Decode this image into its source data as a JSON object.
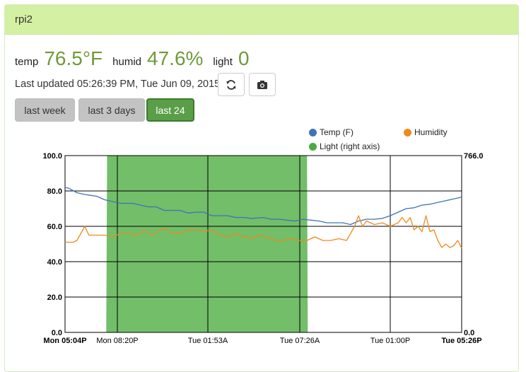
{
  "panel": {
    "title": "rpi2"
  },
  "readings": [
    {
      "label": "temp",
      "value": "76.5°F"
    },
    {
      "label": "humid",
      "value": "47.6%"
    },
    {
      "label": "light",
      "value": "0"
    }
  ],
  "status": {
    "last_updated": "Last updated 05:26:39 PM, Tue Jun 09, 2015"
  },
  "toolbar": {
    "refresh_icon": "refresh-icon",
    "camera_icon": "camera-icon"
  },
  "ranges": [
    {
      "label": "last week",
      "active": false
    },
    {
      "label": "last 3 days",
      "active": false
    },
    {
      "label": "last 24",
      "active": true
    }
  ],
  "colors": {
    "temp": "#3f73b8",
    "humidity": "#f0891d",
    "light": "#4aac3f",
    "accent": "#5a9f48",
    "header": "#d4f0a3"
  },
  "chart_data": {
    "type": "line",
    "x_ticks": [
      "Mon 05:04P",
      "Mon 08:20P",
      "Tue 01:53A",
      "Tue 07:26A",
      "Tue 01:00P",
      "Tue 05:26P"
    ],
    "x_ticks_bold": [
      true,
      false,
      false,
      false,
      false,
      true
    ],
    "y_left_ticks": [
      "100.0",
      "80.0",
      "60.0",
      "40.0",
      "20.0",
      "0.0"
    ],
    "y_right_ticks": [
      "766.0",
      "0.0"
    ],
    "ylim_left": [
      0,
      100
    ],
    "ylim_right": [
      0,
      766
    ],
    "grid": true,
    "legend_position": "top-right",
    "series": [
      {
        "name": "Temp (F)",
        "axis": "left",
        "points": [
          [
            0,
            82
          ],
          [
            0.01,
            81.5
          ],
          [
            0.03,
            79
          ],
          [
            0.05,
            78
          ],
          [
            0.08,
            77
          ],
          [
            0.1,
            75
          ],
          [
            0.12,
            74
          ],
          [
            0.14,
            73
          ],
          [
            0.17,
            73
          ],
          [
            0.19,
            72
          ],
          [
            0.21,
            71
          ],
          [
            0.23,
            71
          ],
          [
            0.25,
            69
          ],
          [
            0.27,
            69
          ],
          [
            0.29,
            69
          ],
          [
            0.31,
            67.5
          ],
          [
            0.33,
            68
          ],
          [
            0.35,
            68
          ],
          [
            0.37,
            66
          ],
          [
            0.39,
            66
          ],
          [
            0.41,
            66
          ],
          [
            0.43,
            65
          ],
          [
            0.45,
            65
          ],
          [
            0.47,
            64.5
          ],
          [
            0.5,
            65
          ],
          [
            0.52,
            64
          ],
          [
            0.54,
            64
          ],
          [
            0.56,
            63.5
          ],
          [
            0.58,
            63
          ],
          [
            0.6,
            64
          ],
          [
            0.62,
            63.5
          ],
          [
            0.64,
            63
          ],
          [
            0.66,
            62
          ],
          [
            0.68,
            62
          ],
          [
            0.7,
            62
          ],
          [
            0.72,
            61
          ],
          [
            0.74,
            63
          ],
          [
            0.76,
            64
          ],
          [
            0.78,
            64
          ],
          [
            0.8,
            64.5
          ],
          [
            0.82,
            66
          ],
          [
            0.84,
            68
          ],
          [
            0.86,
            70
          ],
          [
            0.88,
            70.5
          ],
          [
            0.9,
            72
          ],
          [
            0.92,
            72.5
          ],
          [
            0.94,
            73.5
          ],
          [
            0.96,
            74.5
          ],
          [
            0.98,
            75.5
          ],
          [
            1,
            76.5
          ]
        ]
      },
      {
        "name": "Humidity",
        "axis": "left",
        "points": [
          [
            0,
            51
          ],
          [
            0.02,
            51
          ],
          [
            0.03,
            52
          ],
          [
            0.04,
            56
          ],
          [
            0.05,
            60
          ],
          [
            0.06,
            55
          ],
          [
            0.08,
            55
          ],
          [
            0.1,
            55
          ],
          [
            0.12,
            54
          ],
          [
            0.14,
            56
          ],
          [
            0.16,
            56
          ],
          [
            0.18,
            55
          ],
          [
            0.2,
            58
          ],
          [
            0.22,
            55
          ],
          [
            0.25,
            59
          ],
          [
            0.27,
            56
          ],
          [
            0.29,
            56
          ],
          [
            0.31,
            58
          ],
          [
            0.33,
            58
          ],
          [
            0.35,
            57
          ],
          [
            0.37,
            58
          ],
          [
            0.39,
            55
          ],
          [
            0.41,
            54
          ],
          [
            0.43,
            56
          ],
          [
            0.45,
            54
          ],
          [
            0.47,
            53
          ],
          [
            0.49,
            55
          ],
          [
            0.51,
            54
          ],
          [
            0.53,
            52
          ],
          [
            0.55,
            52
          ],
          [
            0.57,
            53
          ],
          [
            0.59,
            52
          ],
          [
            0.61,
            52
          ],
          [
            0.63,
            54
          ],
          [
            0.65,
            52
          ],
          [
            0.67,
            52
          ],
          [
            0.69,
            53
          ],
          [
            0.71,
            52
          ],
          [
            0.72,
            56
          ],
          [
            0.73,
            60
          ],
          [
            0.74,
            66
          ],
          [
            0.75,
            60
          ],
          [
            0.76,
            63
          ],
          [
            0.78,
            61
          ],
          [
            0.8,
            62
          ],
          [
            0.82,
            60
          ],
          [
            0.84,
            62
          ],
          [
            0.85,
            65
          ],
          [
            0.86,
            62
          ],
          [
            0.87,
            65
          ],
          [
            0.88,
            58
          ],
          [
            0.89,
            60
          ],
          [
            0.9,
            57
          ],
          [
            0.91,
            66
          ],
          [
            0.92,
            57
          ],
          [
            0.93,
            58
          ],
          [
            0.94,
            52
          ],
          [
            0.95,
            48
          ],
          [
            0.96,
            50
          ],
          [
            0.97,
            48
          ],
          [
            0.98,
            49
          ],
          [
            0.99,
            52
          ],
          [
            1,
            47.6
          ]
        ]
      },
      {
        "name": "Light (right axis)",
        "axis": "right",
        "points": [
          [
            0,
            0
          ],
          [
            0.104,
            0
          ],
          [
            0.106,
            766
          ],
          [
            0.61,
            766
          ],
          [
            0.612,
            0
          ],
          [
            1,
            0
          ]
        ]
      }
    ]
  }
}
